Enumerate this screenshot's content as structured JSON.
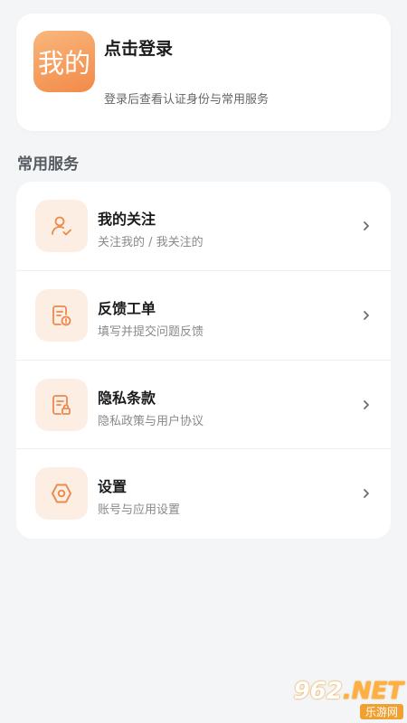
{
  "profile": {
    "logo_text": "我的",
    "login_title": "点击登录",
    "login_subtitle": "登录后查看认证身份与常用服务"
  },
  "section": {
    "title": "常用服务"
  },
  "services": [
    {
      "title": "我的关注",
      "subtitle": "关注我的 / 我关注的",
      "icon": "user-check-icon"
    },
    {
      "title": "反馈工单",
      "subtitle": "填写并提交问题反馈",
      "icon": "feedback-document-icon"
    },
    {
      "title": "隐私条款",
      "subtitle": "隐私政策与用户协议",
      "icon": "privacy-document-lock-icon"
    },
    {
      "title": "设置",
      "subtitle": "账号与应用设置",
      "icon": "settings-hexagon-icon"
    }
  ],
  "watermark": {
    "main": "962",
    "net": ".NET",
    "sub": "乐游网"
  },
  "colors": {
    "accent": "#f28a49",
    "icon_bg": "#fdeee4",
    "page_bg": "#f4f5f7"
  }
}
